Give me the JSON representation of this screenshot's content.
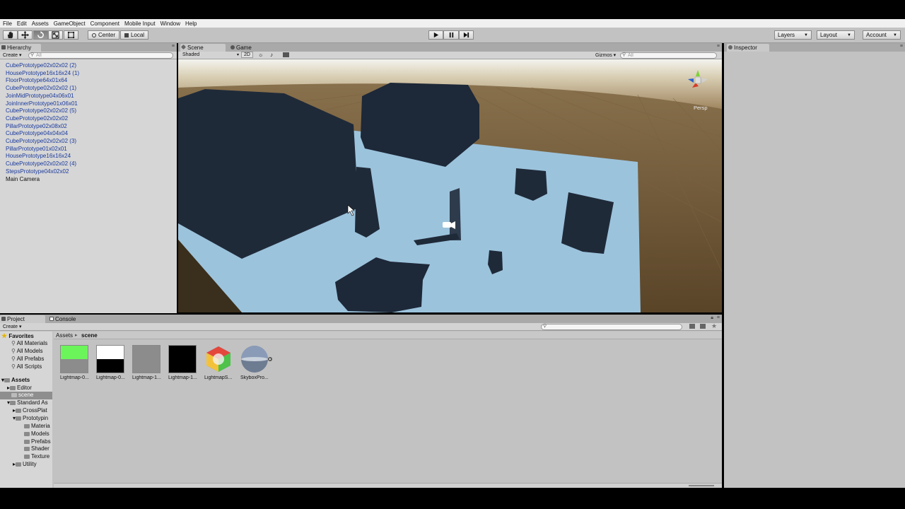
{
  "menu": [
    "File",
    "Edit",
    "Assets",
    "GameObject",
    "Component",
    "Mobile Input",
    "Window",
    "Help"
  ],
  "toolbar": {
    "pivot_label": "Center",
    "space_label": "Local",
    "layers_label": "Layers",
    "layout_label": "Layout",
    "account_label": "Account"
  },
  "hierarchy": {
    "tab_label": "Hierarchy",
    "create_label": "Create",
    "search_placeholder": "All",
    "items": [
      {
        "label": "CubePrototype02x02x02 (2)",
        "prefab": true
      },
      {
        "label": "HousePrototype16x16x24 (1)",
        "prefab": true
      },
      {
        "label": "FloorPrototype64x01x64",
        "prefab": true
      },
      {
        "label": "CubePrototype02x02x02 (1)",
        "prefab": true
      },
      {
        "label": "JoinMidPrototype04x06x01",
        "prefab": true
      },
      {
        "label": "JoinInnerPrototype01x06x01",
        "prefab": true
      },
      {
        "label": "CubePrototype02x02x02 (5)",
        "prefab": true
      },
      {
        "label": "CubePrototype02x02x02",
        "prefab": true
      },
      {
        "label": "PillarPrototype02x08x02",
        "prefab": true
      },
      {
        "label": "CubePrototype04x04x04",
        "prefab": true
      },
      {
        "label": "CubePrototype02x02x02 (3)",
        "prefab": true
      },
      {
        "label": "PillarPrototype01x02x01",
        "prefab": true
      },
      {
        "label": "HousePrototype16x16x24",
        "prefab": true
      },
      {
        "label": "CubePrototype02x02x02 (4)",
        "prefab": true
      },
      {
        "label": "StepsPrototype04x02x02",
        "prefab": true
      },
      {
        "label": "Main Camera",
        "prefab": false
      }
    ]
  },
  "scene": {
    "tab_scene": "Scene",
    "tab_game": "Game",
    "shading_label": "Shaded",
    "mode_2d": "2D",
    "gizmos_label": "Gizmos",
    "search_placeholder": "All",
    "persp_label": "Persp"
  },
  "inspector": {
    "tab_label": "Inspector"
  },
  "project": {
    "tab_project": "Project",
    "tab_console": "Console",
    "create_label": "Create",
    "breadcrumb": [
      "Assets",
      "scene"
    ],
    "favorites_label": "Favorites",
    "favorites": [
      "All Materials",
      "All Models",
      "All Prefabs",
      "All Scripts"
    ],
    "assets_label": "Assets",
    "tree": [
      "Editor",
      "scene",
      "Standard As",
      "CrossPlat",
      "Prototypin",
      "Materia",
      "Models",
      "Prefabs",
      "Shader",
      "Texture",
      "Utility"
    ],
    "assets": [
      {
        "label": "Lightmap-0...",
        "color": "#6cf55a"
      },
      {
        "label": "Lightmap-0...",
        "color": "#ffffff"
      },
      {
        "label": "Lightmap-1...",
        "color": "#8c8c8c"
      },
      {
        "label": "Lightmap-1...",
        "color": "#000000"
      },
      {
        "label": "LightmapS...",
        "color": "#3a7de0"
      },
      {
        "label": "SkyboxPro...",
        "color": "#6e7c92"
      }
    ]
  },
  "colors": {
    "panel": "#c2c2c2",
    "hierarchy_link": "#1a3a9c",
    "floor": "#9cc3dc",
    "object": "#1f2a39",
    "ground": "#6d5a3b"
  }
}
